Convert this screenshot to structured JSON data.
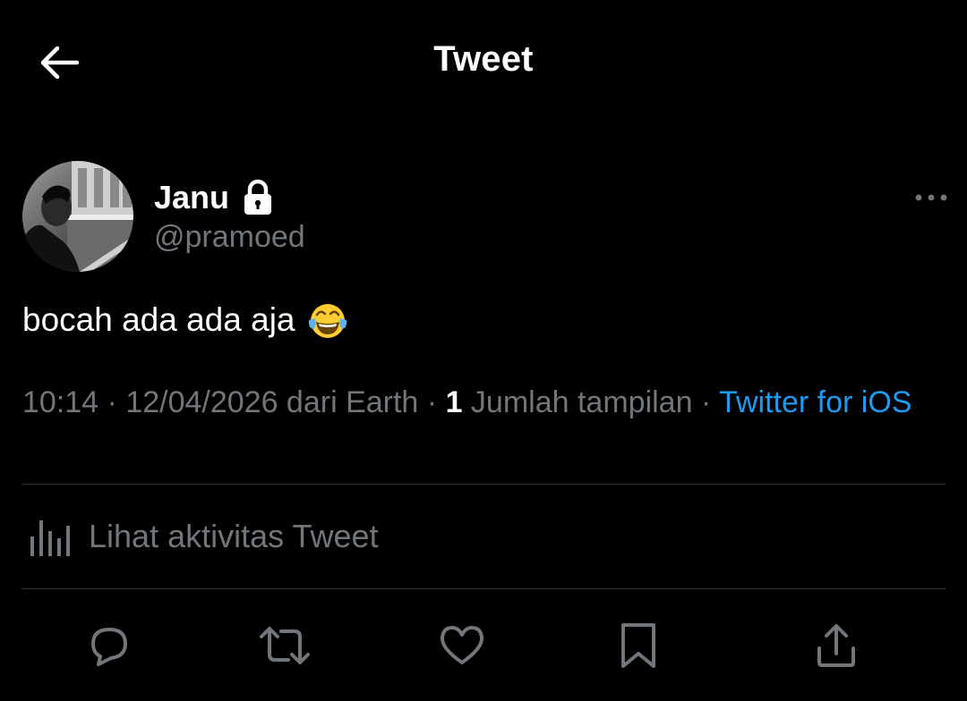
{
  "header": {
    "title": "Tweet",
    "back_icon": "arrow-left-icon"
  },
  "author": {
    "name": "Janu",
    "handle": "@pramoed",
    "protected_icon": "lock-icon"
  },
  "tweet": {
    "text": "bocah ada ada aja",
    "emoji": "face-with-tears-of-joy"
  },
  "meta": {
    "time": "10:14",
    "sep1": " · ",
    "date_location": "12/04/2026 dari Earth",
    "sep2": " · ",
    "views_count": "1",
    "views_label": " Jumlah tampilan",
    "sep3": " · ",
    "source": "Twitter for iOS"
  },
  "activity": {
    "label": "Lihat aktivitas Tweet",
    "icon": "bar-chart-icon"
  },
  "actions": {
    "reply_icon": "reply-icon",
    "retweet_icon": "retweet-icon",
    "like_icon": "heart-icon",
    "bookmark_icon": "bookmark-icon",
    "share_icon": "share-icon"
  },
  "colors": {
    "background": "#000000",
    "primary_text": "#ffffff",
    "secondary_text": "#71767b",
    "accent": "#1d9bf0",
    "divider": "#2f3336"
  }
}
